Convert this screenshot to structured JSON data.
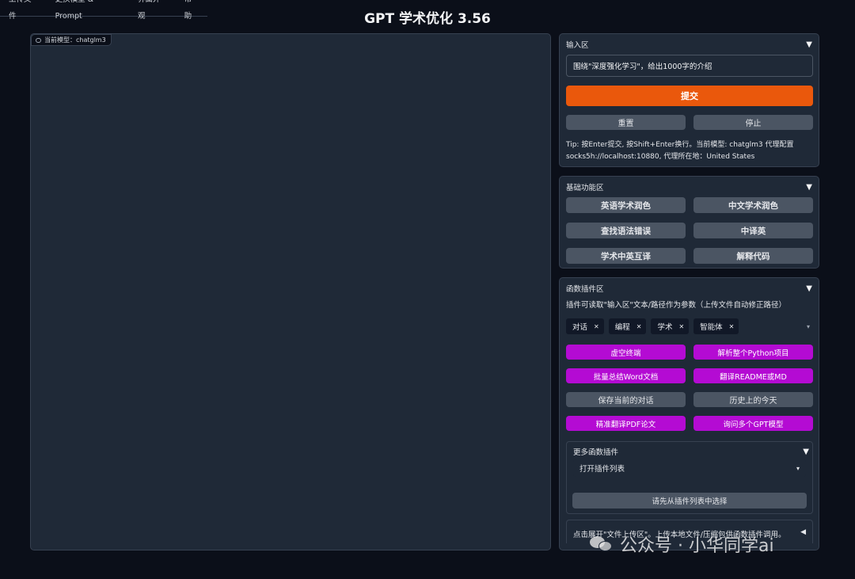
{
  "nav": [
    "上传文件",
    "更换模型 & Prompt",
    "界面外观",
    "帮助"
  ],
  "title": "GPT 学术优化 3.56",
  "chat": {
    "model_label": "当前模型：chatglm3"
  },
  "input_panel": {
    "title": "输入区",
    "value": "围绕\"深度强化学习\"，给出1000字的介绍",
    "submit": "提交",
    "reset": "重置",
    "stop": "停止",
    "tip": "Tip: 按Enter提交, 按Shift+Enter换行。当前模型: chatglm3 代理配置socks5h://localhost:10880, 代理所在地：United States"
  },
  "basic_panel": {
    "title": "基础功能区",
    "buttons": [
      "英语学术润色",
      "中文学术润色",
      "查找语法错误",
      "中译英",
      "学术中英互译",
      "解释代码"
    ]
  },
  "plugin_panel": {
    "title": "函数插件区",
    "desc": "插件可读取\"输入区\"文本/路径作为参数（上传文件自动修正路径）",
    "tags": [
      "对话",
      "编程",
      "学术",
      "智能体"
    ],
    "buttons": [
      "虚空终端",
      "解析整个Python项目",
      "批量总结Word文档",
      "翻译README或MD",
      "保存当前的对话",
      "历史上的今天",
      "精准翻译PDF论文",
      "询问多个GPT模型"
    ],
    "more": {
      "title": "更多函数插件",
      "select": "打开插件列表",
      "choose": "请先从插件列表中选择"
    },
    "upload_hint": "点击展开\"文件上传区\"。上传本地文件/压缩包供函数插件调用。"
  },
  "watermark": "公众号 · 小华同学ai",
  "colors": {
    "accent_orange": "#ea580c",
    "plugin_purple": "#b40bd3",
    "panel": "#1f2937",
    "background": "#0b0f19"
  }
}
